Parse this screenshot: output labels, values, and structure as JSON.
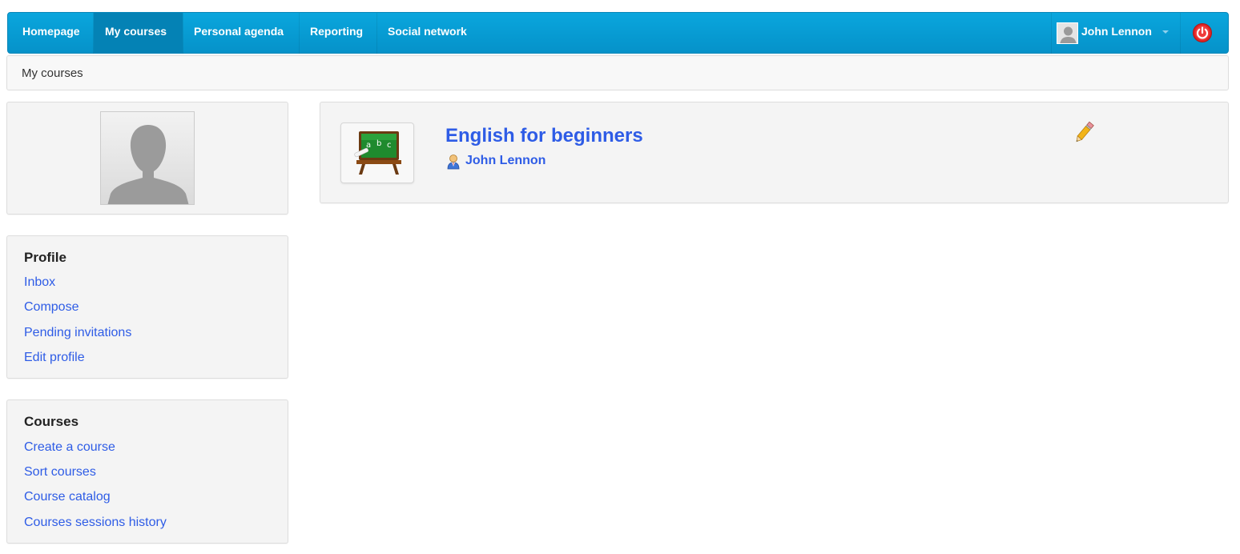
{
  "navbar": {
    "items": [
      {
        "label": "Homepage",
        "active": false
      },
      {
        "label": "My courses",
        "active": true
      },
      {
        "label": "Personal agenda",
        "active": false
      },
      {
        "label": "Reporting",
        "active": false
      },
      {
        "label": "Social network",
        "active": false
      }
    ],
    "user_name": "John Lennon",
    "logout_icon": "power-icon"
  },
  "breadcrumb": {
    "current": "My courses"
  },
  "profile": {
    "title": "Profile",
    "links": [
      "Inbox",
      "Compose",
      "Pending invitations",
      "Edit profile"
    ]
  },
  "courses_block": {
    "title": "Courses",
    "links": [
      "Create a course",
      "Sort courses",
      "Course catalog",
      "Courses sessions history"
    ]
  },
  "course": {
    "title": "English for beginners",
    "teacher": "John Lennon",
    "thumbnail_icon": "blackboard-abc-icon",
    "edit_icon": "pencil-icon"
  },
  "colors": {
    "navbar": "#0aa6dd",
    "link": "#2e5ce6",
    "panel_bg": "#f4f4f4"
  }
}
